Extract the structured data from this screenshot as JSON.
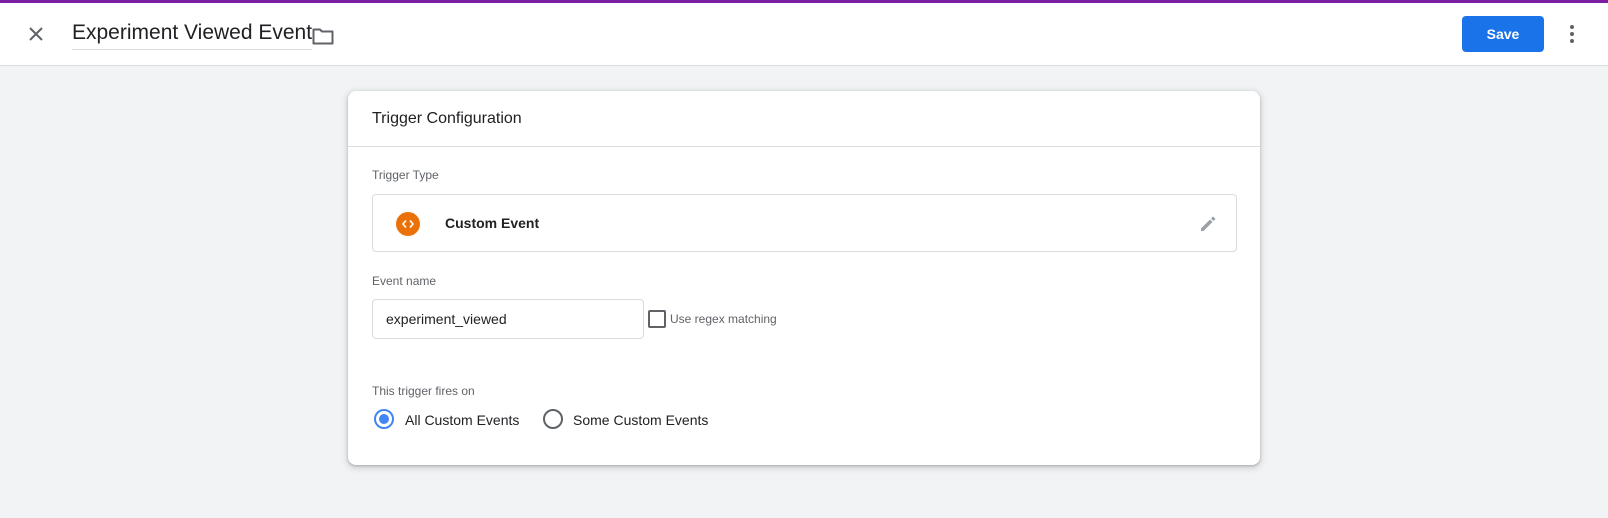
{
  "colors": {
    "accent_bar": "#7b1fa2",
    "primary_button": "#1a73e8",
    "trigger_icon": "#e8710a",
    "radio_selected": "#4285f4"
  },
  "header": {
    "close_icon": "close-icon",
    "title": "Experiment Viewed Event",
    "folder_icon": "folder-icon",
    "save_label": "Save",
    "more_icon": "more-vert-icon"
  },
  "card": {
    "title": "Trigger Configuration",
    "trigger_type": {
      "label": "Trigger Type",
      "icon": "code-icon",
      "name": "Custom Event",
      "edit_icon": "pencil-icon"
    },
    "event_name": {
      "label": "Event name",
      "value": "experiment_viewed"
    },
    "regex": {
      "label": "Use regex matching",
      "checked": false
    },
    "fires_on": {
      "label": "This trigger fires on",
      "options": [
        {
          "label": "All Custom Events",
          "selected": true
        },
        {
          "label": "Some Custom Events",
          "selected": false
        }
      ]
    }
  }
}
